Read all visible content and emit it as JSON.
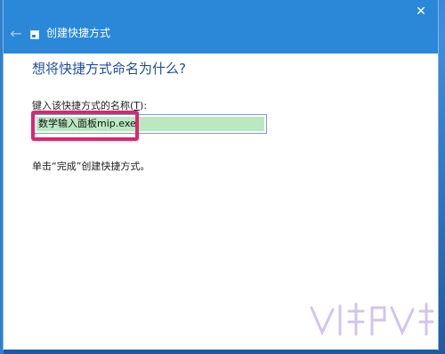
{
  "window": {
    "title": "创建快捷方式",
    "back_icon": "back-arrow-icon",
    "close_icon": "close-icon"
  },
  "wizard": {
    "heading": "想将快捷方式命名为什么?",
    "field_label": "键入该快捷方式的名称(",
    "field_accel": "T",
    "field_label_end": "):",
    "input_value": "数学输入面板mip.exe",
    "hint": "单击“完成”创建快捷方式。"
  },
  "colors": {
    "title_bar": "#2b88d8",
    "heading": "#1e4f99",
    "highlight": "#e0246e",
    "selection": "#b9e8c1"
  }
}
